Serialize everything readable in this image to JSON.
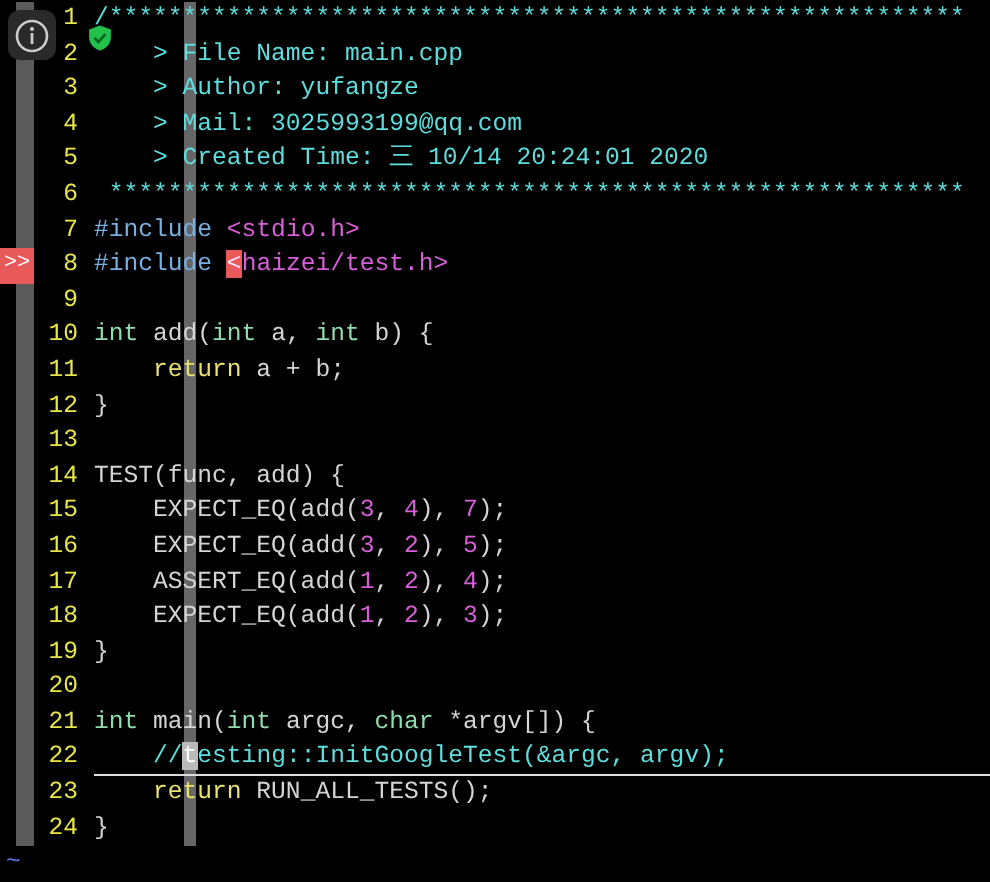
{
  "editor": {
    "lines": [
      {
        "number": "1",
        "cursorline": false,
        "tokens": [
          {
            "kind": "comment",
            "text": "/**********************************************************"
          }
        ]
      },
      {
        "number": "2",
        "cursorline": false,
        "tokens": [
          {
            "kind": "comment",
            "text": "    > File Name: main.cpp"
          }
        ]
      },
      {
        "number": "3",
        "cursorline": false,
        "tokens": [
          {
            "kind": "comment",
            "text": "    > Author: yufangze"
          }
        ]
      },
      {
        "number": "4",
        "cursorline": false,
        "tokens": [
          {
            "kind": "comment",
            "text": "    > Mail: 3025993199@qq.com"
          }
        ]
      },
      {
        "number": "5",
        "cursorline": false,
        "tokens": [
          {
            "kind": "comment",
            "text": "    > Created Time: 三 10/14 20:24:01 2020"
          }
        ]
      },
      {
        "number": "6",
        "cursorline": false,
        "tokens": [
          {
            "kind": "comment",
            "text": " **********************************************************"
          }
        ]
      },
      {
        "number": "7",
        "cursorline": false,
        "tokens": [
          {
            "kind": "preproc",
            "text": "#include "
          },
          {
            "kind": "string",
            "text": "<stdio.h>"
          }
        ]
      },
      {
        "number": "8",
        "cursorline": false,
        "sign": ">>",
        "tokens": [
          {
            "kind": "preproc",
            "text": "#include "
          },
          {
            "kind": "error",
            "text": "<"
          },
          {
            "kind": "string",
            "text": "haizei/test.h>"
          }
        ]
      },
      {
        "number": "9",
        "cursorline": false
      },
      {
        "number": "10",
        "cursorline": false,
        "tokens": [
          {
            "kind": "type",
            "text": "int"
          },
          {
            "kind": "plain",
            "text": " add("
          },
          {
            "kind": "type",
            "text": "int"
          },
          {
            "kind": "plain",
            "text": " a, "
          },
          {
            "kind": "type",
            "text": "int"
          },
          {
            "kind": "plain",
            "text": " b) {"
          }
        ]
      },
      {
        "number": "11",
        "cursorline": false,
        "tokens": [
          {
            "kind": "statement",
            "text": "    return"
          },
          {
            "kind": "plain",
            "text": " a + b;"
          }
        ]
      },
      {
        "number": "12",
        "cursorline": false,
        "tokens": [
          {
            "kind": "plain",
            "text": "}"
          }
        ]
      },
      {
        "number": "13",
        "cursorline": false
      },
      {
        "number": "14",
        "cursorline": false,
        "tokens": [
          {
            "kind": "plain",
            "text": "TEST(func, add) {"
          }
        ]
      },
      {
        "number": "15",
        "cursorline": false,
        "tokens": [
          {
            "kind": "plain",
            "text": "    EXPECT_EQ(add("
          },
          {
            "kind": "number",
            "text": "3"
          },
          {
            "kind": "plain",
            "text": ", "
          },
          {
            "kind": "number",
            "text": "4"
          },
          {
            "kind": "plain",
            "text": "), "
          },
          {
            "kind": "number",
            "text": "7"
          },
          {
            "kind": "plain",
            "text": ");"
          }
        ]
      },
      {
        "number": "16",
        "cursorline": false,
        "tokens": [
          {
            "kind": "plain",
            "text": "    EXPECT_EQ(add("
          },
          {
            "kind": "number",
            "text": "3"
          },
          {
            "kind": "plain",
            "text": ", "
          },
          {
            "kind": "number",
            "text": "2"
          },
          {
            "kind": "plain",
            "text": "), "
          },
          {
            "kind": "number",
            "text": "5"
          },
          {
            "kind": "plain",
            "text": ");"
          }
        ]
      },
      {
        "number": "17",
        "cursorline": false,
        "tokens": [
          {
            "kind": "plain",
            "text": "    ASSERT_EQ(add("
          },
          {
            "kind": "number",
            "text": "1"
          },
          {
            "kind": "plain",
            "text": ", "
          },
          {
            "kind": "number",
            "text": "2"
          },
          {
            "kind": "plain",
            "text": "), "
          },
          {
            "kind": "number",
            "text": "4"
          },
          {
            "kind": "plain",
            "text": ");"
          }
        ]
      },
      {
        "number": "18",
        "cursorline": false,
        "tokens": [
          {
            "kind": "plain",
            "text": "    EXPECT_EQ(add("
          },
          {
            "kind": "number",
            "text": "1"
          },
          {
            "kind": "plain",
            "text": ", "
          },
          {
            "kind": "number",
            "text": "2"
          },
          {
            "kind": "plain",
            "text": "), "
          },
          {
            "kind": "number",
            "text": "3"
          },
          {
            "kind": "plain",
            "text": ");"
          }
        ]
      },
      {
        "number": "19",
        "cursorline": false,
        "tokens": [
          {
            "kind": "plain",
            "text": "}"
          }
        ]
      },
      {
        "number": "20",
        "cursorline": false
      },
      {
        "number": "21",
        "cursorline": false,
        "tokens": [
          {
            "kind": "type",
            "text": "int"
          },
          {
            "kind": "plain",
            "text": " main("
          },
          {
            "kind": "type",
            "text": "int"
          },
          {
            "kind": "plain",
            "text": " argc, "
          },
          {
            "kind": "type",
            "text": "char"
          },
          {
            "kind": "plain",
            "text": " *argv[]) {"
          }
        ]
      },
      {
        "number": "22",
        "cursorline": true,
        "tokens": [
          {
            "kind": "comment",
            "text": "    //"
          },
          {
            "kind": "cursor",
            "text": "t"
          },
          {
            "kind": "comment",
            "text": "esting::InitGoogleTest(&argc, argv);"
          }
        ]
      },
      {
        "number": "23",
        "cursorline": false,
        "tokens": [
          {
            "kind": "statement",
            "text": "    return"
          },
          {
            "kind": "plain",
            "text": " RUN_ALL_TESTS();"
          }
        ]
      },
      {
        "number": "24",
        "cursorline": false,
        "tokens": [
          {
            "kind": "plain",
            "text": "}"
          }
        ]
      }
    ],
    "end_marker": "~"
  }
}
